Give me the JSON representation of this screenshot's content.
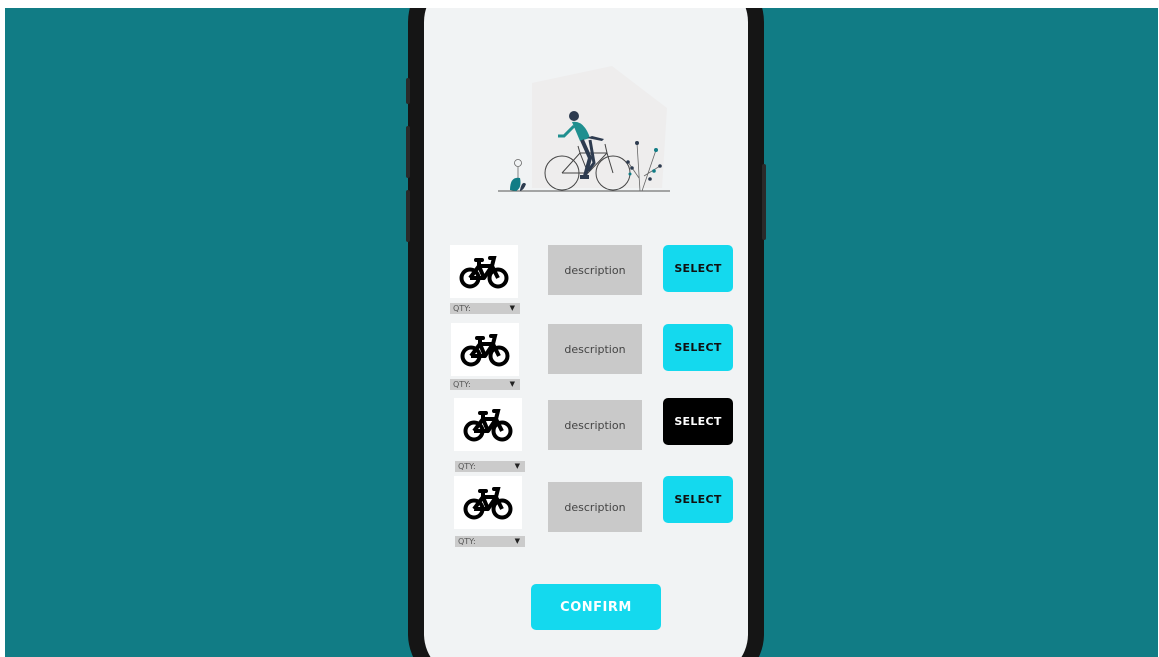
{
  "screen": {
    "products": [
      {
        "qty_label": "QTY:",
        "description": "description",
        "select_label": "SELECT",
        "selected": false,
        "icon": "bicycle-icon"
      },
      {
        "qty_label": "QTY:",
        "description": "description",
        "select_label": "SELECT",
        "selected": false,
        "icon": "bicycle-icon"
      },
      {
        "qty_label": "QTY:",
        "description": "description",
        "select_label": "SELECT",
        "selected": true,
        "icon": "bicycle-icon"
      },
      {
        "qty_label": "QTY:",
        "description": "description",
        "select_label": "SELECT",
        "selected": false,
        "icon": "bicycle-icon"
      }
    ],
    "confirm_label": "CONFIRM",
    "illustration": "person-riding-bicycle-illustration"
  },
  "colors": {
    "background": "#117c85",
    "accent": "#14d9ee",
    "selected": "#000000",
    "screen": "#f1f3f4"
  }
}
